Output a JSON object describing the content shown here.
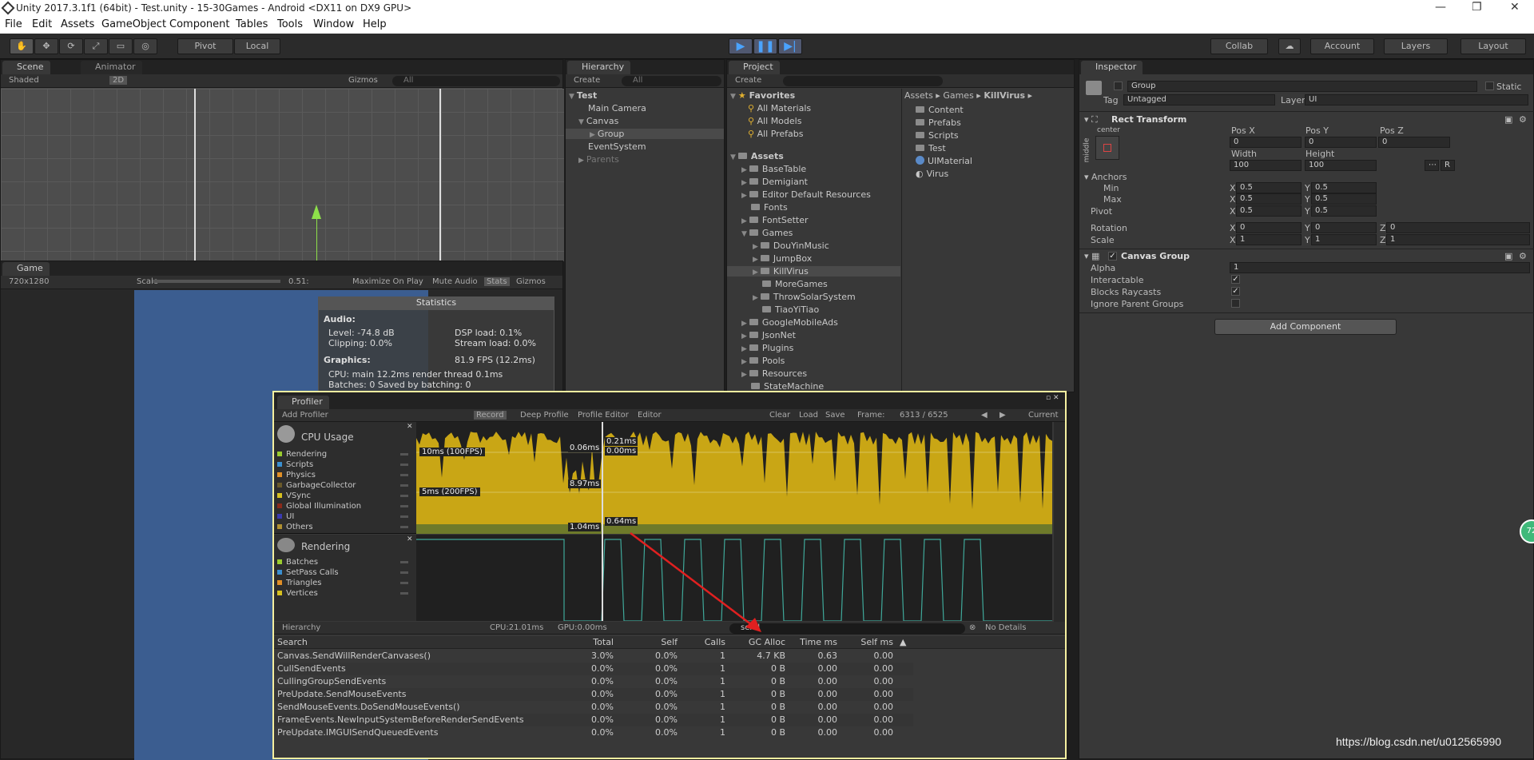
{
  "window": {
    "title": "Unity 2017.3.1f1 (64bit) - Test.unity - 15-30Games - Android <DX11 on DX9 GPU>"
  },
  "menu": [
    "File",
    "Edit",
    "Assets",
    "GameObject",
    "Component",
    "Tables",
    "Tools",
    "Window",
    "Help"
  ],
  "toolbar": {
    "pivot": "Pivot",
    "local": "Local",
    "collab": "Collab",
    "account": "Account",
    "layers": "Layers",
    "layout": "Layout"
  },
  "scene": {
    "tab": "Scene",
    "tab2": "Animator",
    "shading": "Shaded",
    "mode2d": "2D",
    "gizmos": "Gizmos",
    "search": "All"
  },
  "game": {
    "tab": "Game",
    "resolution": "720x1280",
    "scale_label": "Scale",
    "scale_value": "0.51:",
    "maximize": "Maximize On Play",
    "mute": "Mute Audio",
    "stats": "Stats",
    "gizmos": "Gizmos"
  },
  "stats": {
    "title": "Statistics",
    "audio_h": "Audio:",
    "level": "Level: -74.8 dB",
    "dsp": "DSP load: 0.1%",
    "clipping": "Clipping: 0.0%",
    "stream": "Stream load: 0.0%",
    "graphics_h": "Graphics:",
    "fps": "81.9 FPS (12.2ms)",
    "cpu": "CPU: main 12.2ms  render thread 0.1ms",
    "batches": "Batches: 0   Saved by batching: 0"
  },
  "hierarchy": {
    "tab": "Hierarchy",
    "create": "Create",
    "search": "All",
    "scene": "Test",
    "items": [
      "Main Camera",
      "Canvas",
      "Group",
      "EventSystem",
      "Parents"
    ]
  },
  "project": {
    "tab": "Project",
    "create": "Create",
    "favorites": "Favorites",
    "fav_items": [
      "All Materials",
      "All Models",
      "All Prefabs"
    ],
    "assets": "Assets",
    "folders": [
      "BaseTable",
      "Demigiant",
      "Editor Default Resources",
      "Fonts",
      "FontSetter",
      "Games"
    ],
    "games": [
      "DouYinMusic",
      "JumpBox",
      "KillVirus",
      "MoreGames",
      "ThrowSolarSystem",
      "TiaoYiTiao"
    ],
    "folders2": [
      "GoogleMobileAds",
      "JsonNet",
      "Plugins",
      "Pools",
      "Resources",
      "StateMachine"
    ],
    "breadcrumb": [
      "Assets",
      "Games",
      "KillVirus"
    ],
    "right_items": [
      "Content",
      "Prefabs",
      "Scripts",
      "Test",
      "UIMaterial",
      "Virus"
    ]
  },
  "inspector": {
    "tab": "Inspector",
    "name": "Group",
    "static": "Static",
    "tag_label": "Tag",
    "tag": "Untagged",
    "layer_label": "Layer",
    "layer": "UI",
    "rect": "Rect Transform",
    "center": "center",
    "middle": "middle",
    "posx_l": "Pos X",
    "posy_l": "Pos Y",
    "posz_l": "Pos Z",
    "posx": "0",
    "posy": "0",
    "posz": "0",
    "width_l": "Width",
    "height_l": "Height",
    "width": "100",
    "height": "100",
    "anchors": "Anchors",
    "min": "Min",
    "max": "Max",
    "pivot": "Pivot",
    "x": "X",
    "y": "Y",
    "z": "Z",
    "half": "0.5",
    "rotation": "Rotation",
    "scale": "Scale",
    "zero": "0",
    "one": "1",
    "r": "R",
    "cg": "Canvas Group",
    "alpha_l": "Alpha",
    "alpha": "1",
    "interactable": "Interactable",
    "blocks": "Blocks Raycasts",
    "ignore": "Ignore Parent Groups",
    "add": "Add Component"
  },
  "profiler": {
    "tab": "Profiler",
    "add": "Add Profiler",
    "record": "Record",
    "deep": "Deep Profile",
    "editor_btn": "Profile Editor",
    "editor": "Editor",
    "clear": "Clear",
    "load": "Load",
    "save": "Save",
    "frame_l": "Frame:",
    "frame": "6313 / 6525",
    "current": "Current",
    "cpu": "CPU Usage",
    "cpu_legend": [
      "Rendering",
      "Scripts",
      "Physics",
      "GarbageCollector",
      "VSync",
      "Global Illumination",
      "UI",
      "Others"
    ],
    "cpu_colors": [
      "#9acc2e",
      "#3a8fd0",
      "#e08f26",
      "#6a5a2a",
      "#d6c020",
      "#8a2a1a",
      "#3a3ab0",
      "#b09030"
    ],
    "rendering": "Rendering",
    "rend_legend": [
      "Batches",
      "SetPass Calls",
      "Triangles",
      "Vertices"
    ],
    "rend_colors": [
      "#9acc2e",
      "#3a8fd0",
      "#e08f26",
      "#d6c020"
    ],
    "lbl10": "10ms (100FPS)",
    "lbl5": "5ms (200FPS)",
    "v1": "0.06ms",
    "v2": "0.21ms",
    "v3": "0.00ms",
    "v4": "8.97ms",
    "v5": "1.04ms",
    "v6": "0.64ms",
    "view": "Hierarchy",
    "cpu_time": "CPU:21.01ms",
    "gpu_time": "GPU:0.00ms",
    "filter": "send",
    "details": "No Details",
    "cols": [
      "Search",
      "Total",
      "Self",
      "Calls",
      "GC Alloc",
      "Time ms",
      "Self ms"
    ],
    "rows": [
      [
        "Canvas.SendWillRenderCanvases()",
        "3.0%",
        "0.0%",
        "1",
        "4.7 KB",
        "0.63",
        "0.00"
      ],
      [
        "CullSendEvents",
        "0.0%",
        "0.0%",
        "1",
        "0 B",
        "0.00",
        "0.00"
      ],
      [
        "CullingGroupSendEvents",
        "0.0%",
        "0.0%",
        "1",
        "0 B",
        "0.00",
        "0.00"
      ],
      [
        "PreUpdate.SendMouseEvents",
        "0.0%",
        "0.0%",
        "1",
        "0 B",
        "0.00",
        "0.00"
      ],
      [
        "SendMouseEvents.DoSendMouseEvents()",
        "0.0%",
        "0.0%",
        "1",
        "0 B",
        "0.00",
        "0.00"
      ],
      [
        "FrameEvents.NewInputSystemBeforeRenderSendEvents",
        "0.0%",
        "0.0%",
        "1",
        "0 B",
        "0.00",
        "0.00"
      ],
      [
        "PreUpdate.IMGUISendQueuedEvents",
        "0.0%",
        "0.0%",
        "1",
        "0 B",
        "0.00",
        "0.00"
      ]
    ]
  },
  "watermark": "https://blog.csdn.net/u012565990",
  "badge": "72"
}
